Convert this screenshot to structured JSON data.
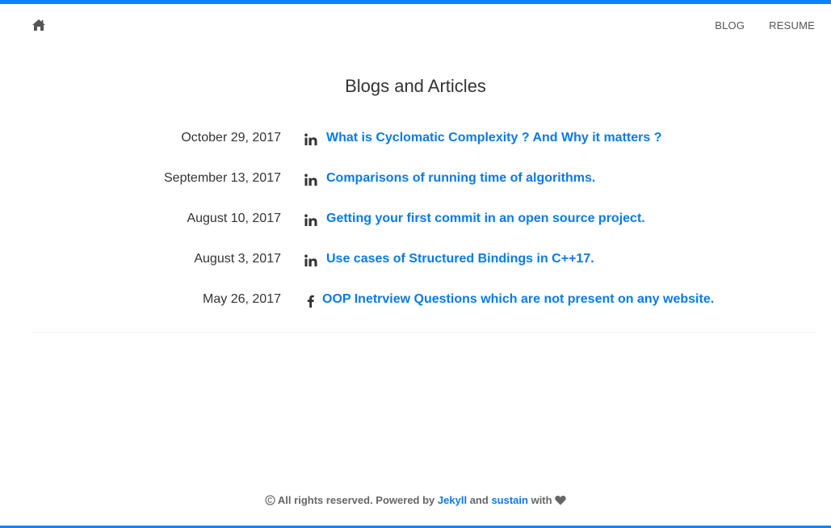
{
  "nav": {
    "home_icon": "home-icon",
    "items": [
      {
        "label": "BLOG"
      },
      {
        "label": "RESUME"
      }
    ]
  },
  "title": "Blogs and Articles",
  "posts": [
    {
      "date": "October 29, 2017",
      "icon": "linkedin-icon",
      "title": "What is Cyclomatic Complexity ? And Why it matters ?"
    },
    {
      "date": "September 13, 2017",
      "icon": "linkedin-icon",
      "title": "Comparisons of running time of algorithms."
    },
    {
      "date": "August 10, 2017",
      "icon": "linkedin-icon",
      "title": "Getting your first commit in an open source project."
    },
    {
      "date": "August 3, 2017",
      "icon": "linkedin-icon",
      "title": "Use cases of Structured Bindings in C++17."
    },
    {
      "date": "May 26, 2017",
      "icon": "facebook-icon",
      "title": "OOP Inetrview Questions which are not present on any website."
    }
  ],
  "footer": {
    "copyright_icon": "copyright-icon",
    "text_prefix": "All rights reserved. Powered by",
    "link1": "Jekyll",
    "and": "and",
    "link2": "sustain",
    "with": "with",
    "heart_icon": "heart-icon"
  },
  "colors": {
    "accent": "#0a84ff",
    "link": "#0a7ae8",
    "text": "#333333"
  }
}
